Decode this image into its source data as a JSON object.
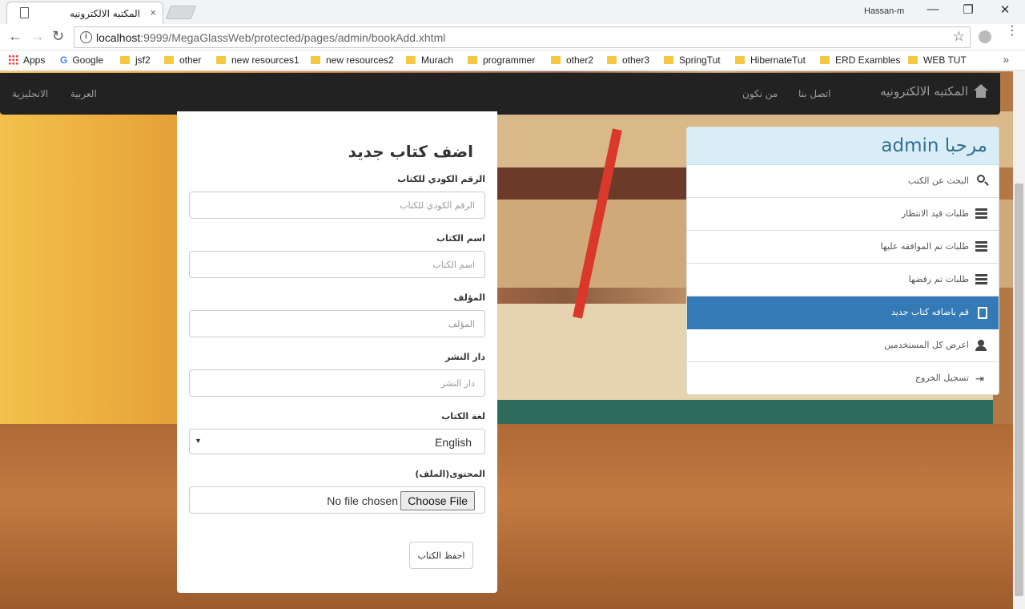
{
  "browser": {
    "tab_title": "المكتبه الالكترونيه",
    "tab_close": "×",
    "profile": "Hassan-m",
    "url_host": "localhost",
    "url_rest": ":9999/MegaGlassWeb/protected/pages/admin/bookAdd.xhtml",
    "win_min": "—",
    "win_max": "❐",
    "win_close": "✕",
    "back": "←",
    "forward": "→",
    "reload": "↻",
    "star": "☆",
    "menu": "⋮",
    "info": "i"
  },
  "bookmarks": {
    "apps": "Apps",
    "google": "Google",
    "items": [
      "jsf2",
      "other",
      "new resources1",
      "new resources2",
      "Murach",
      "programmer",
      "other2",
      "other3",
      "SpringTut",
      "HibernateTut",
      "ERD Exambles",
      "WEB TUT"
    ],
    "more": "»"
  },
  "navbar": {
    "brand": "المكتبه الالكترونيه",
    "links": [
      "من نكون",
      "اتصل بنا"
    ],
    "lang_arabic": "العربية",
    "lang_english": "الانجليزية"
  },
  "form": {
    "title": "اضف كتاب جديد",
    "code_label": "الرقم الكودي للكتاب",
    "code_placeholder": "الرقم الكودي للكتاب",
    "name_label": "اسم الكتاب",
    "name_placeholder": "اسم الكتاب",
    "author_label": "المؤلف",
    "author_placeholder": "المؤلف",
    "publisher_label": "دار النشر",
    "publisher_placeholder": "دار النشر",
    "language_label": "لغة الكتاب",
    "language_value": "English",
    "file_label": "المحتوى(الملف)",
    "file_button": "Choose File",
    "file_status": "No file chosen",
    "save_button": "احفظ الكتاب"
  },
  "sidebar": {
    "welcome": "مرحبا admin",
    "items": [
      {
        "label": "البحث عن الكتب",
        "icon": "search-icon"
      },
      {
        "label": "طلبات قيد الانتظار",
        "icon": "list-icon"
      },
      {
        "label": "طلبات تم الموافقه عليها",
        "icon": "list-icon"
      },
      {
        "label": "طلبات تم رفضها",
        "icon": "list-icon"
      },
      {
        "label": "قم باضافه كتاب جديد",
        "icon": "book-icon",
        "active": true
      },
      {
        "label": "اعرض كل المستخدمين",
        "icon": "user-icon"
      },
      {
        "label": "تسجيل الخروج",
        "icon": "logout-icon"
      }
    ]
  },
  "colors": {
    "navbar": "#222222",
    "active_item": "#337ab7",
    "panel_heading": "#d9edf7"
  }
}
